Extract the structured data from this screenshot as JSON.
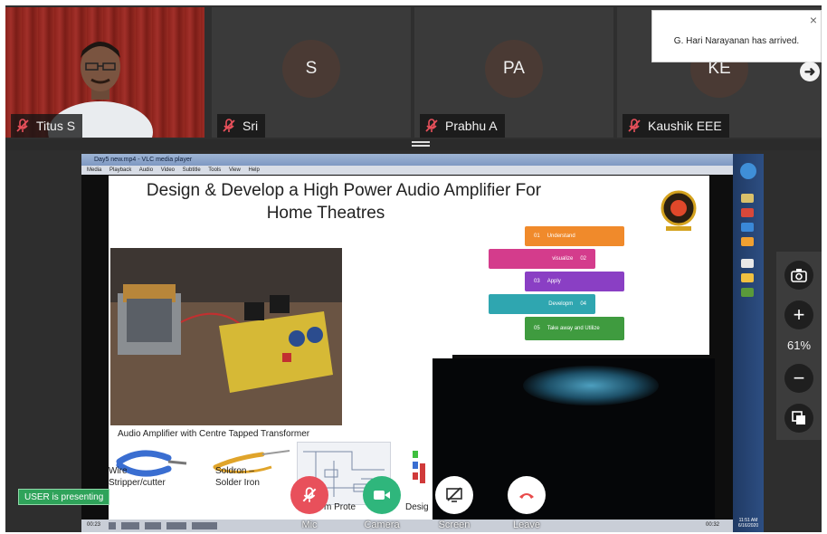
{
  "participants": [
    {
      "name": "Titus S",
      "initials": "",
      "muted": true,
      "has_video": true
    },
    {
      "name": "Sri",
      "initials": "S",
      "muted": true,
      "has_video": false
    },
    {
      "name": "Prabhu A",
      "initials": "PA",
      "muted": true,
      "has_video": false
    },
    {
      "name": "Kaushik EEE",
      "initials": "KE",
      "muted": true,
      "has_video": false
    }
  ],
  "toast": {
    "message": "G. Hari Narayanan has arrived.",
    "close_icon": "×"
  },
  "next_arrow_icon": "➜",
  "shared_screen": {
    "window_title": "Day5 new.mp4 - VLC media player",
    "menu": [
      "Media",
      "Playback",
      "Audio",
      "Video",
      "Subtitle",
      "Tools",
      "View",
      "Help"
    ],
    "slide": {
      "title_line1": "Design & Develop a High Power Audio Amplifier For",
      "title_line2": "Home Theatres",
      "steps": [
        {
          "num": "01",
          "label": "Understand",
          "color": "#f08a2b"
        },
        {
          "num": "02",
          "label": "visualize",
          "color": "#d43c8c"
        },
        {
          "num": "03",
          "label": "Apply",
          "color": "#8a3fc4"
        },
        {
          "num": "04",
          "label": "Developm",
          "color": "#2fa6b0"
        },
        {
          "num": "05",
          "label": "Take away and Utilize",
          "color": "#3f9b3f"
        }
      ],
      "amp_caption": "Audio Amplifier with Centre Tapped Transformer",
      "tool1_line1": "Wire",
      "tool1_line2": "Stripper/cutter",
      "tool2_line1": "Soldron –",
      "tool2_line2": "Solder Iron",
      "partial_label_1": "m Prote",
      "partial_label_2": "Desig"
    },
    "time_left": "00:23",
    "time_right": "00:32",
    "clock_time": "11:51 AM",
    "clock_date": "6/16/2020"
  },
  "side_tools": {
    "camera_icon": "camera-icon",
    "zoom_in_label": "+",
    "zoom_level": "61%",
    "zoom_out_label": "−"
  },
  "presenting_label": "USER is presenting",
  "controls": {
    "mic_label": "Mic",
    "camera_label": "Camera",
    "screen_label": "Screen",
    "leave_label": "Leave",
    "mic_color": "#e8505b",
    "camera_color": "#2fb67c",
    "screen_color": "#ffffff",
    "leave_color": "#ffffff"
  }
}
